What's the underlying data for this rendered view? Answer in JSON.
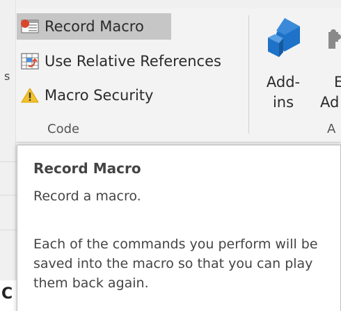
{
  "ribbon": {
    "left_cut_text": "s",
    "code_group": {
      "commands": [
        {
          "label": "Record Macro",
          "icon": "record-macro-icon"
        },
        {
          "label": "Use Relative References",
          "icon": "relative-references-icon"
        },
        {
          "label": "Macro Security",
          "icon": "warning-icon"
        }
      ],
      "label": "Code"
    },
    "addins_group": {
      "addins_button": {
        "line1": "Add-",
        "line2": "ins"
      },
      "excel_addins_button": {
        "line1": "E",
        "line2": "Ad"
      },
      "label_partial": "A"
    }
  },
  "tooltip": {
    "title": "Record Macro",
    "description": "Record a macro.",
    "body": "Each of the commands you perform will be saved into the macro so that you can play them back again."
  },
  "background": {
    "partial_letter": "C"
  },
  "colors": {
    "record_highlight": "#c6c6c6",
    "addins_blue": "#1e73c8",
    "warning_yellow": "#f2c12e",
    "record_red": "#d9472b"
  }
}
